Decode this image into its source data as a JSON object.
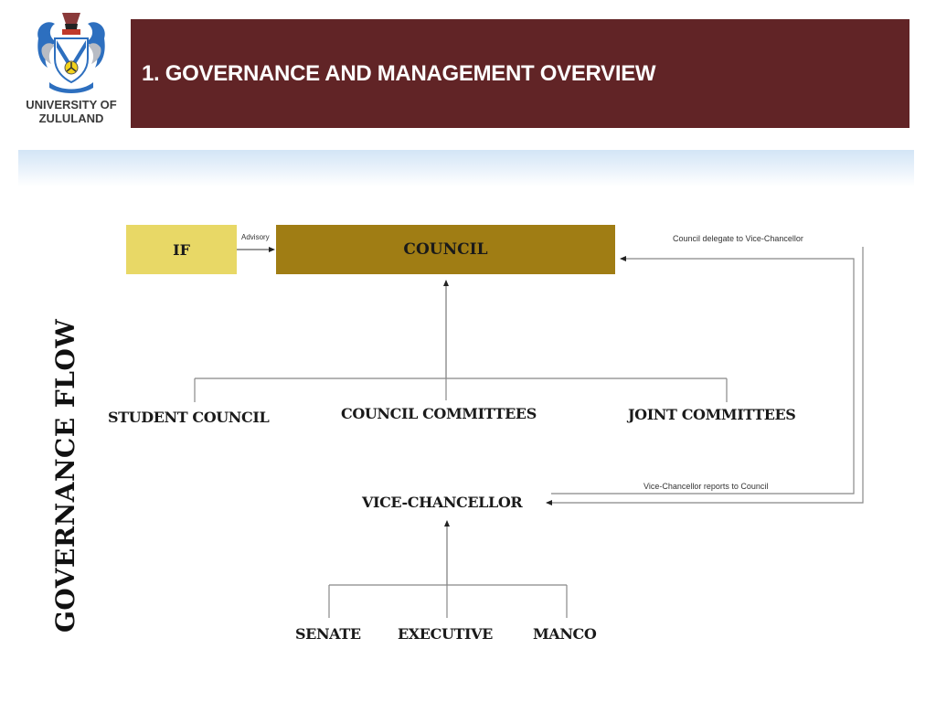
{
  "logo": {
    "icon": "university-crest-icon",
    "line1": "UNIVERSITY OF",
    "line2": "ZULULAND"
  },
  "header": {
    "title": "1. GOVERNANCE AND MANAGEMENT OVERVIEW",
    "bar_color": "#612426"
  },
  "diagram": {
    "side_title": "GOVERNANCE FLOW",
    "boxes": {
      "if": {
        "label": "IF",
        "color": "#e8d866"
      },
      "council": {
        "label": "COUNCIL",
        "color": "#a07d14"
      }
    },
    "edge_labels": {
      "advisory": "Advisory",
      "council_delegate": "Council delegate  to Vice-Chancellor",
      "vc_reports": "Vice-Chancellor  reports to Council"
    },
    "council_children": [
      "STUDENT COUNCIL",
      "COUNCIL COMMITTEES",
      "JOINT COMMITTEES"
    ],
    "vice_chancellor": "VICE-CHANCELLOR",
    "vc_children": [
      "SENATE",
      "EXECUTIVE",
      "MANCO"
    ]
  }
}
